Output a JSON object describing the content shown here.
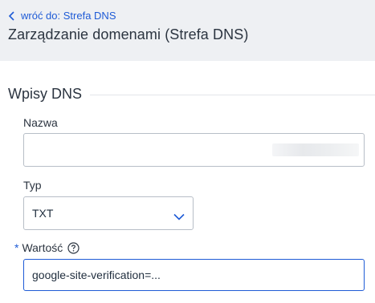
{
  "header": {
    "back_label": "wróć do: Strefa DNS",
    "title": "Zarządzanie domenami (Strefa DNS)"
  },
  "section": {
    "title": "Wpisy DNS"
  },
  "form": {
    "name_label": "Nazwa",
    "name_value": "",
    "type_label": "Typ",
    "type_value": "TXT",
    "value_label": "Wartość",
    "value_required_mark": "*",
    "value_value": "google-site-verification=..."
  },
  "icons": {
    "back": "chevron-left-icon",
    "help": "help-circle-icon",
    "dropdown": "chevron-down-icon"
  },
  "colors": {
    "accent": "#1e5bd6",
    "header_bg": "#eef0f3",
    "text": "#2b3440"
  }
}
